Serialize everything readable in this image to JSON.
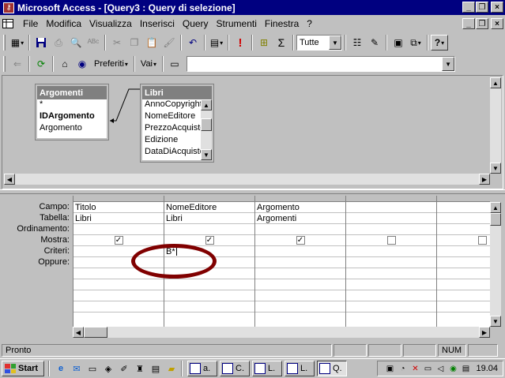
{
  "window": {
    "title": "Microsoft Access - [Query3 : Query di selezione]",
    "minimize": "_",
    "restore": "❐",
    "close": "×"
  },
  "menu": {
    "items": [
      "File",
      "Modifica",
      "Visualizza",
      "Inserisci",
      "Query",
      "Strumenti",
      "Finestra",
      "?"
    ]
  },
  "toolbar1": {
    "view_combo": "Tutte"
  },
  "toolbar2": {
    "favorites": "Preferiti",
    "go": "Vai",
    "address": ""
  },
  "tables": [
    {
      "name": "Argomenti",
      "fields": [
        "*",
        "IDArgomento",
        "Argomento"
      ],
      "bold_field": "IDArgomento"
    },
    {
      "name": "Libri",
      "fields": [
        "AnnoCopyright",
        "NomeEditore",
        "PrezzoAcquisto",
        "Edizione",
        "DataDiAcquisto"
      ]
    }
  ],
  "grid": {
    "row_labels": [
      "Campo:",
      "Tabella:",
      "Ordinamento:",
      "Mostra:",
      "Criteri:",
      "Oppure:"
    ],
    "columns": [
      {
        "campo": "Titolo",
        "tabella": "Libri",
        "ordinamento": "",
        "mostra": true,
        "criteri": "",
        "oppure": ""
      },
      {
        "campo": "NomeEditore",
        "tabella": "Libri",
        "ordinamento": "",
        "mostra": true,
        "criteri": "B*",
        "oppure": ""
      },
      {
        "campo": "Argomento",
        "tabella": "Argomenti",
        "ordinamento": "",
        "mostra": true,
        "criteri": "",
        "oppure": ""
      },
      {
        "campo": "",
        "tabella": "",
        "ordinamento": "",
        "mostra": false,
        "criteri": "",
        "oppure": ""
      },
      {
        "campo": "",
        "tabella": "",
        "ordinamento": "",
        "mostra": false,
        "criteri": "",
        "oppure": ""
      }
    ]
  },
  "status": {
    "text": "Pronto",
    "num": "NUM"
  },
  "taskbar": {
    "start": "Start",
    "items": [
      "a.",
      "C.",
      "L.",
      "L.",
      "Q."
    ],
    "clock": "19.04"
  }
}
